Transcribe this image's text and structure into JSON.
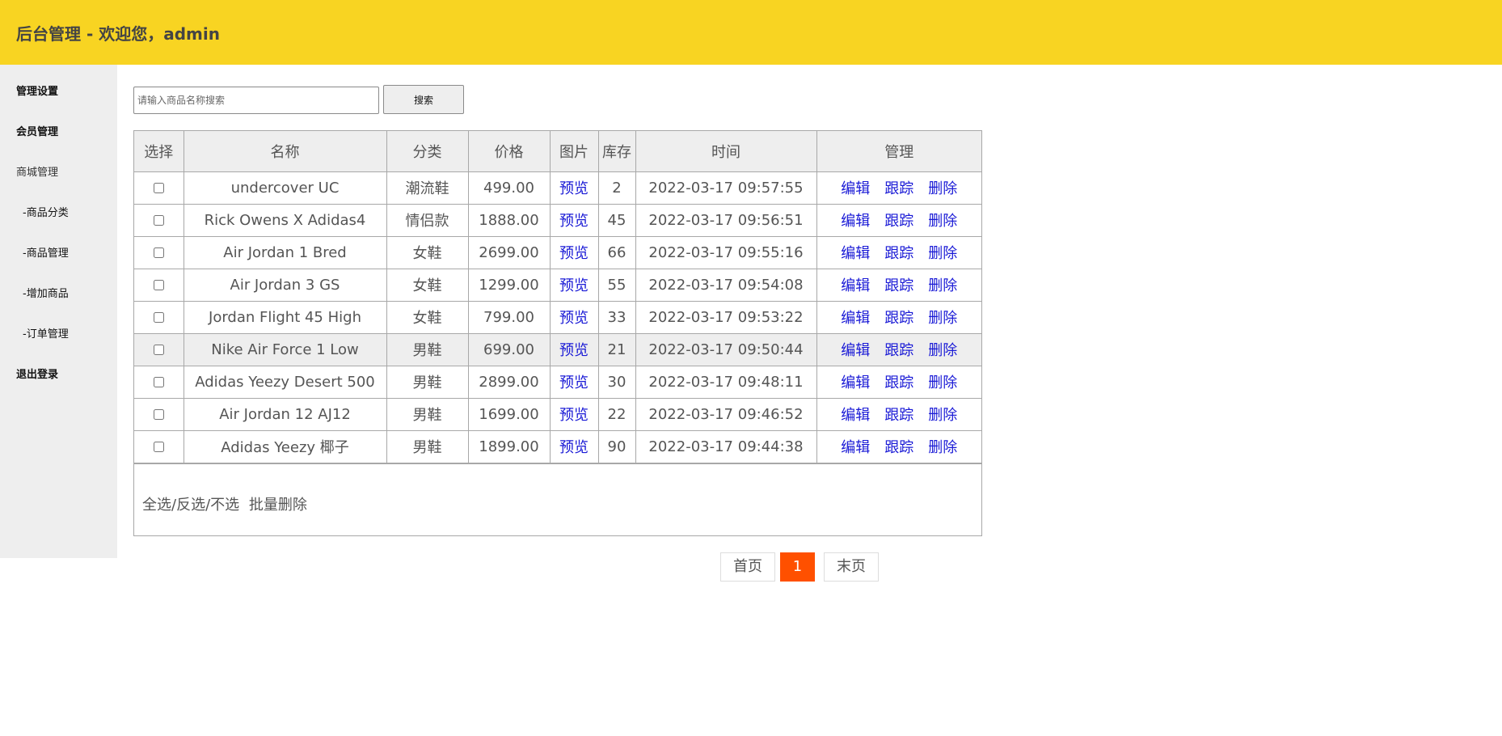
{
  "header": {
    "title": "后台管理 - 欢迎您，admin"
  },
  "sidebar": {
    "items": [
      {
        "label": "管理设置"
      },
      {
        "label": "会员管理"
      },
      {
        "label": "商城管理"
      },
      {
        "label": "-商品分类"
      },
      {
        "label": "-商品管理"
      },
      {
        "label": "-增加商品"
      },
      {
        "label": "-订单管理"
      },
      {
        "label": "退出登录"
      }
    ]
  },
  "search": {
    "placeholder": "请输入商品名称搜索",
    "value": "",
    "button_label": "搜索"
  },
  "table": {
    "headers": [
      "选择",
      "名称",
      "分类",
      "价格",
      "图片",
      "库存",
      "时间",
      "管理"
    ],
    "preview_label": "预览",
    "action_labels": [
      "编辑",
      "跟踪",
      "删除"
    ],
    "rows": [
      {
        "name": "undercover UC",
        "category": "潮流鞋",
        "price": "499.00",
        "stock": "2",
        "time": "2022-03-17 09:57:55"
      },
      {
        "name": "Rick Owens X Adidas4",
        "category": "情侣款",
        "price": "1888.00",
        "stock": "45",
        "time": "2022-03-17 09:56:51"
      },
      {
        "name": "Air Jordan 1 Bred",
        "category": "女鞋",
        "price": "2699.00",
        "stock": "66",
        "time": "2022-03-17 09:55:16"
      },
      {
        "name": "Air Jordan 3 GS",
        "category": "女鞋",
        "price": "1299.00",
        "stock": "55",
        "time": "2022-03-17 09:54:08"
      },
      {
        "name": "Jordan Flight 45 High",
        "category": "女鞋",
        "price": "799.00",
        "stock": "33",
        "time": "2022-03-17 09:53:22"
      },
      {
        "name": "Nike Air Force 1 Low",
        "category": "男鞋",
        "price": "699.00",
        "stock": "21",
        "time": "2022-03-17 09:50:44"
      },
      {
        "name": "Adidas Yeezy Desert 500",
        "category": "男鞋",
        "price": "2899.00",
        "stock": "30",
        "time": "2022-03-17 09:48:11"
      },
      {
        "name": "Air Jordan 12 AJ12",
        "category": "男鞋",
        "price": "1699.00",
        "stock": "22",
        "time": "2022-03-17 09:46:52"
      },
      {
        "name": "Adidas Yeezy 椰子",
        "category": "男鞋",
        "price": "1899.00",
        "stock": "90",
        "time": "2022-03-17 09:44:38"
      }
    ]
  },
  "footer": {
    "select_all": "全选",
    "invert": "反选",
    "select_none": "不选",
    "separator": "/",
    "batch_delete": "批量删除"
  },
  "pagination": {
    "first": "首页",
    "current": "1",
    "last": "末页"
  },
  "colors": {
    "header_bg": "#f8d422",
    "sidebar_bg": "#eeeeee",
    "link": "#1a1ad6",
    "page_active": "#ff5000"
  }
}
